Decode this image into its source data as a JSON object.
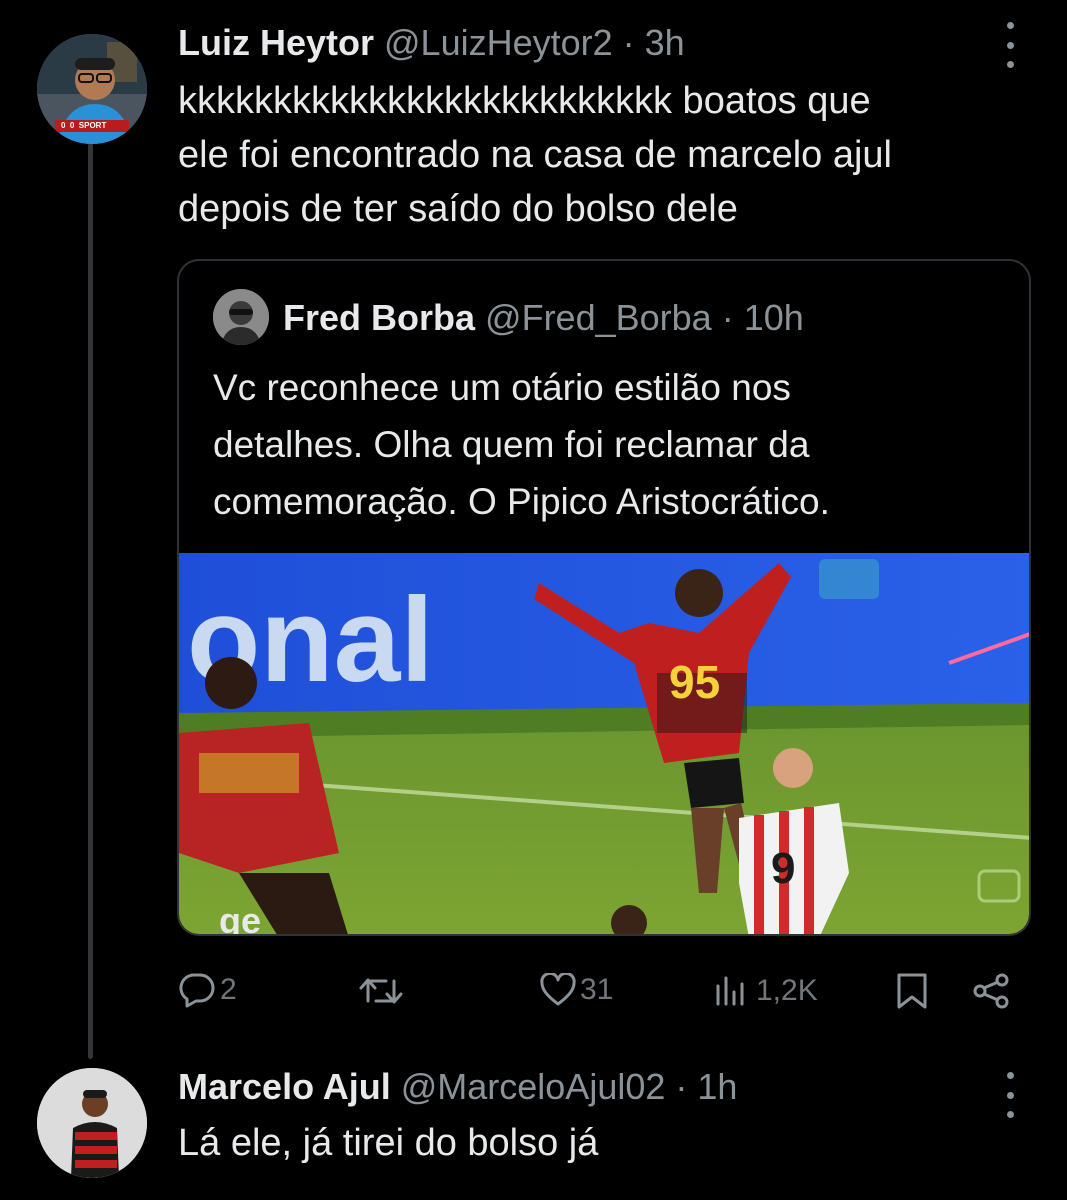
{
  "thread_line": true,
  "tweet1": {
    "name": "Luiz Heytor",
    "handle": "@LuizHeytor2",
    "separator": "·",
    "time": "3h",
    "text": "kkkkkkkkkkkkkkkkkkkkkkkkkk boatos que\nele foi encontrado na casa de marcelo ajul\ndepois de ter saído do bolso dele",
    "avatar_overlay": "0  0  SPORT"
  },
  "quote": {
    "name": "Fred Borba",
    "handle": "@Fred_Borba",
    "separator": "·",
    "time": "10h",
    "text": "Vc reconhece um otário estilão nos\ndetalhes. Olha quem foi reclamar da\ncomemoração. O Pipico Aristocrático.",
    "image": {
      "banner_text": "onal",
      "jersey_number": "95",
      "jersey_number_2": "9",
      "corner_text": "ge"
    }
  },
  "actions": {
    "replies": "2",
    "retweets": "",
    "likes": "31",
    "views": "1,2K"
  },
  "tweet2": {
    "name": "Marcelo Ajul",
    "handle": "@MarceloAjul02",
    "separator": "·",
    "time": "1h",
    "text": "Lá ele, já tirei do bolso já"
  },
  "colors": {
    "background": "#000000",
    "text": "#e7e9ea",
    "muted": "#71767b",
    "border": "#2f3336"
  }
}
